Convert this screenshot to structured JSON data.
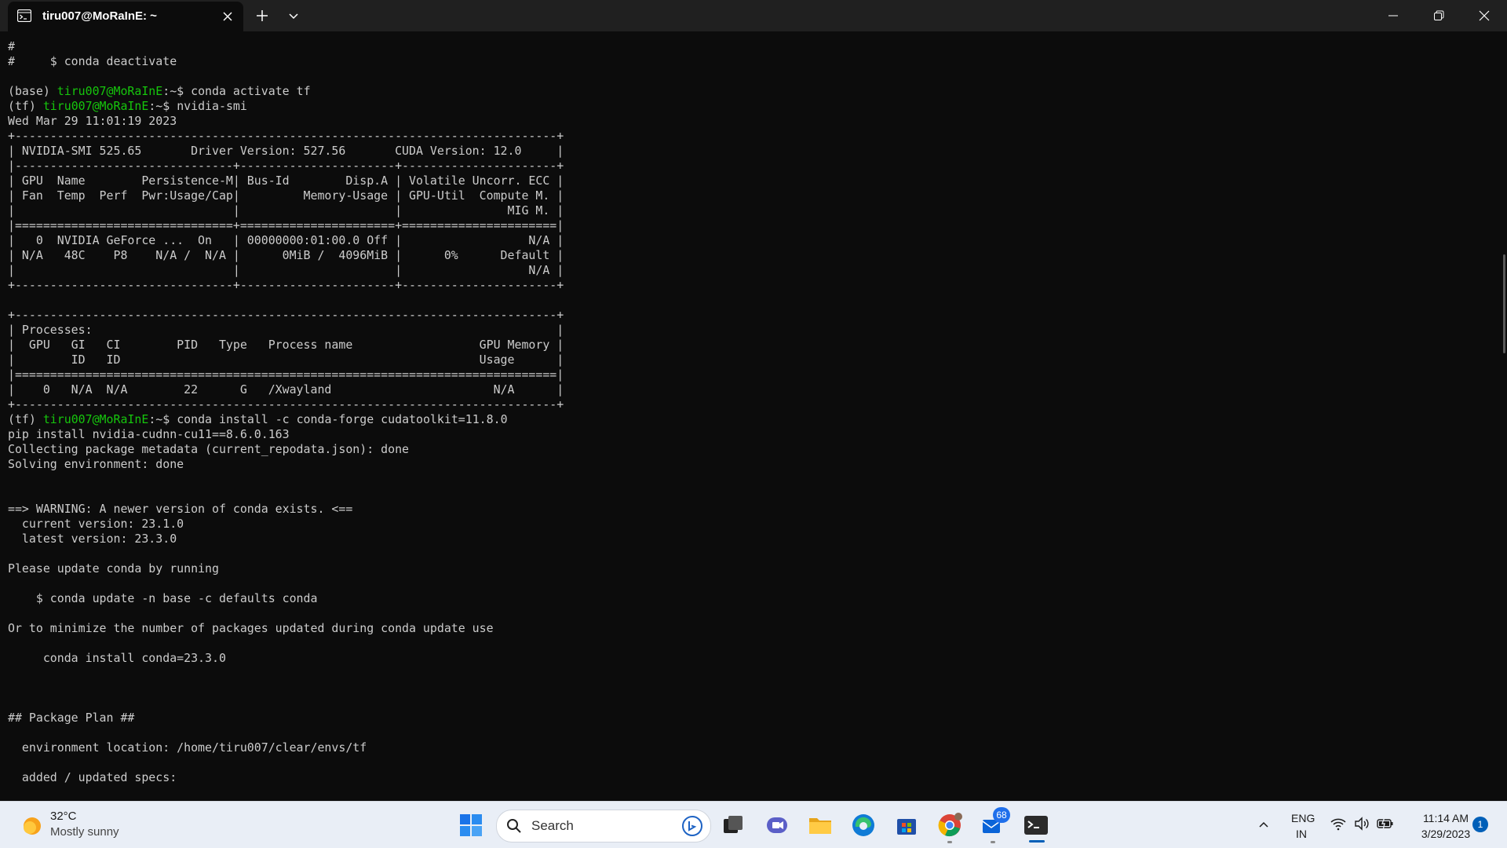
{
  "window": {
    "tab_title": "tiru007@MoRaInE: ~",
    "new_tab_label": "+",
    "dropdown_label": "⌄"
  },
  "terminal": {
    "lines": [
      {
        "type": "text",
        "text": "#"
      },
      {
        "type": "text",
        "text": "#     $ conda deactivate"
      },
      {
        "type": "text",
        "text": ""
      },
      {
        "type": "prompt",
        "env": "(base) ",
        "user": "tiru007@MoRaInE",
        "sep": ":~$ ",
        "cmd": "conda activate tf"
      },
      {
        "type": "prompt",
        "env": "(tf) ",
        "user": "tiru007@MoRaInE",
        "sep": ":~$ ",
        "cmd": "nvidia-smi"
      },
      {
        "type": "text",
        "text": "Wed Mar 29 11:01:19 2023"
      },
      {
        "type": "text",
        "text": "+-----------------------------------------------------------------------------+"
      },
      {
        "type": "text",
        "text": "| NVIDIA-SMI 525.65       Driver Version: 527.56       CUDA Version: 12.0     |"
      },
      {
        "type": "text",
        "text": "|-------------------------------+----------------------+----------------------+"
      },
      {
        "type": "text",
        "text": "| GPU  Name        Persistence-M| Bus-Id        Disp.A | Volatile Uncorr. ECC |"
      },
      {
        "type": "text",
        "text": "| Fan  Temp  Perf  Pwr:Usage/Cap|         Memory-Usage | GPU-Util  Compute M. |"
      },
      {
        "type": "text",
        "text": "|                               |                      |               MIG M. |"
      },
      {
        "type": "text",
        "text": "|===============================+======================+======================|"
      },
      {
        "type": "text",
        "text": "|   0  NVIDIA GeForce ...  On   | 00000000:01:00.0 Off |                  N/A |"
      },
      {
        "type": "text",
        "text": "| N/A   48C    P8    N/A /  N/A |      0MiB /  4096MiB |      0%      Default |"
      },
      {
        "type": "text",
        "text": "|                               |                      |                  N/A |"
      },
      {
        "type": "text",
        "text": "+-------------------------------+----------------------+----------------------+"
      },
      {
        "type": "text",
        "text": ""
      },
      {
        "type": "text",
        "text": "+-----------------------------------------------------------------------------+"
      },
      {
        "type": "text",
        "text": "| Processes:                                                                  |"
      },
      {
        "type": "text",
        "text": "|  GPU   GI   CI        PID   Type   Process name                  GPU Memory |"
      },
      {
        "type": "text",
        "text": "|        ID   ID                                                   Usage      |"
      },
      {
        "type": "text",
        "text": "|=============================================================================|"
      },
      {
        "type": "text",
        "text": "|    0   N/A  N/A        22      G   /Xwayland                       N/A      |"
      },
      {
        "type": "text",
        "text": "+-----------------------------------------------------------------------------+"
      },
      {
        "type": "prompt",
        "env": "(tf) ",
        "user": "tiru007@MoRaInE",
        "sep": ":~$ ",
        "cmd": "conda install -c conda-forge cudatoolkit=11.8.0"
      },
      {
        "type": "text",
        "text": "pip install nvidia-cudnn-cu11==8.6.0.163"
      },
      {
        "type": "text",
        "text": "Collecting package metadata (current_repodata.json): done"
      },
      {
        "type": "text",
        "text": "Solving environment: done"
      },
      {
        "type": "text",
        "text": ""
      },
      {
        "type": "text",
        "text": ""
      },
      {
        "type": "text",
        "text": "==> WARNING: A newer version of conda exists. <=="
      },
      {
        "type": "text",
        "text": "  current version: 23.1.0"
      },
      {
        "type": "text",
        "text": "  latest version: 23.3.0"
      },
      {
        "type": "text",
        "text": ""
      },
      {
        "type": "text",
        "text": "Please update conda by running"
      },
      {
        "type": "text",
        "text": ""
      },
      {
        "type": "text",
        "text": "    $ conda update -n base -c defaults conda"
      },
      {
        "type": "text",
        "text": ""
      },
      {
        "type": "text",
        "text": "Or to minimize the number of packages updated during conda update use"
      },
      {
        "type": "text",
        "text": ""
      },
      {
        "type": "text",
        "text": "     conda install conda=23.3.0"
      },
      {
        "type": "text",
        "text": ""
      },
      {
        "type": "text",
        "text": ""
      },
      {
        "type": "text",
        "text": ""
      },
      {
        "type": "text",
        "text": "## Package Plan ##"
      },
      {
        "type": "text",
        "text": ""
      },
      {
        "type": "text",
        "text": "  environment location: /home/tiru007/clear/envs/tf"
      },
      {
        "type": "text",
        "text": ""
      },
      {
        "type": "text",
        "text": "  added / updated specs:"
      }
    ]
  },
  "taskbar": {
    "weather_temp": "32°C",
    "weather_desc": "Mostly sunny",
    "search_placeholder": "Search",
    "mail_badge": "68",
    "lang_line1": "ENG",
    "lang_line2": "IN",
    "time": "11:14 AM",
    "date": "3/29/2023",
    "notification_count": "1"
  },
  "colors": {
    "terminal_bg": "#0c0c0c",
    "terminal_fg": "#cccccc",
    "prompt_user": "#16c60c",
    "accent": "#005fb8"
  }
}
